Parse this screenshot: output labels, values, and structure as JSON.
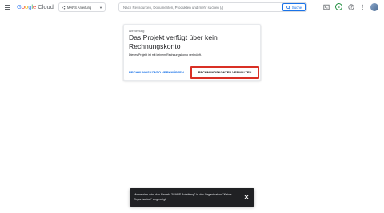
{
  "header": {
    "logo": {
      "g": "G",
      "o1": "o",
      "o2": "o",
      "g2": "g",
      "l": "l",
      "e": "e",
      "suffix": "Cloud"
    },
    "project_picker": {
      "label": "MAPS Anleitung"
    },
    "search": {
      "placeholder": "Nach Ressourcen, Dokumenten, Produkten und mehr suchen (/)",
      "button_label": "Suche"
    },
    "notification_count": "3"
  },
  "dialog": {
    "kicker": "Abrechnung",
    "title": "Das Projekt verfügt über kein Rechnungskonto",
    "body": "Dieses Projekt ist mit keinem Rechnungskonto verknüpft.",
    "link_button": "RECHNUNGSKONTO VERKNÜPFEN",
    "manage_button": "RECHNUNGSKONTEN VERWALTEN"
  },
  "toast": {
    "message": "Momentan wird das Projekt \"MAPS Anleitung\" in der Organisation \"Keine Organisation\" angezeigt"
  },
  "colors": {
    "accent": "#1a73e8",
    "highlight": "#d93025",
    "toast_bg": "#202124",
    "notification": "#1e8e3e"
  }
}
